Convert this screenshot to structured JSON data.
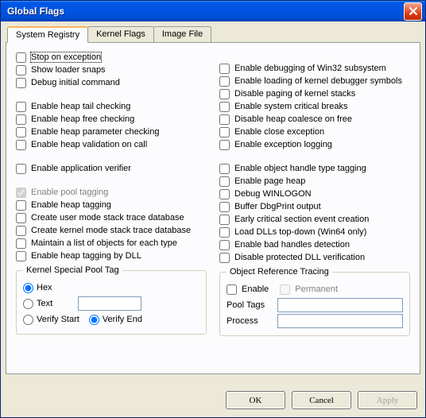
{
  "window": {
    "title": "Global Flags"
  },
  "tabs": [
    {
      "label": "System Registry",
      "active": true
    },
    {
      "label": "Kernel Flags",
      "active": false
    },
    {
      "label": "Image File",
      "active": false
    }
  ],
  "left_column": {
    "group1": [
      {
        "label": "Stop on exception",
        "checked": false
      },
      {
        "label": "Show loader snaps",
        "checked": false
      },
      {
        "label": "Debug initial command",
        "checked": false
      }
    ],
    "group2": [
      {
        "label": "Enable heap tail checking",
        "checked": false
      },
      {
        "label": "Enable heap free checking",
        "checked": false
      },
      {
        "label": "Enable heap parameter checking",
        "checked": false
      },
      {
        "label": "Enable heap validation on call",
        "checked": false
      }
    ],
    "group3": [
      {
        "label": "Enable application verifier",
        "checked": false
      }
    ],
    "group4": [
      {
        "label": "Enable pool tagging",
        "checked": true,
        "disabled": true
      },
      {
        "label": "Enable heap tagging",
        "checked": false
      },
      {
        "label": "Create user mode stack trace database",
        "checked": false
      },
      {
        "label": "Create kernel mode stack trace database",
        "checked": false
      },
      {
        "label": "Maintain a list of objects for each type",
        "checked": false
      },
      {
        "label": "Enable heap tagging by DLL",
        "checked": false
      }
    ]
  },
  "right_column": {
    "group1": [
      {
        "label": "Enable debugging of Win32 subsystem",
        "checked": false
      },
      {
        "label": "Enable loading of kernel debugger symbols",
        "checked": false
      },
      {
        "label": "Disable paging of kernel stacks",
        "checked": false
      },
      {
        "label": "Enable system critical breaks",
        "checked": false
      },
      {
        "label": "Disable heap coalesce on free",
        "checked": false
      },
      {
        "label": "Enable close exception",
        "checked": false
      },
      {
        "label": "Enable exception logging",
        "checked": false
      }
    ],
    "group2": [
      {
        "label": "Enable object handle type tagging",
        "checked": false
      },
      {
        "label": "Enable page heap",
        "checked": false
      },
      {
        "label": "Debug WINLOGON",
        "checked": false
      },
      {
        "label": "Buffer DbgPrint output",
        "checked": false
      },
      {
        "label": "Early critical section event creation",
        "checked": false
      },
      {
        "label": "Load DLLs top-down (Win64 only)",
        "checked": false
      },
      {
        "label": "Enable bad handles detection",
        "checked": false
      },
      {
        "label": "Disable protected DLL verification",
        "checked": false
      }
    ]
  },
  "kernel_pool": {
    "legend": "Kernel Special Pool Tag",
    "mode": {
      "hex": "Hex",
      "text": "Text",
      "selected": "hex",
      "text_value": ""
    },
    "verify": {
      "start": "Verify Start",
      "end": "Verify End",
      "selected": "end"
    }
  },
  "object_ref": {
    "legend": "Object Reference Tracing",
    "enable_label": "Enable",
    "permanent_label": "Permanent",
    "enable_checked": false,
    "permanent_checked": false,
    "permanent_disabled": true,
    "pool_tags_label": "Pool Tags",
    "pool_tags_value": "",
    "process_label": "Process",
    "process_value": ""
  },
  "buttons": {
    "ok": "OK",
    "cancel": "Cancel",
    "apply": "Apply"
  }
}
